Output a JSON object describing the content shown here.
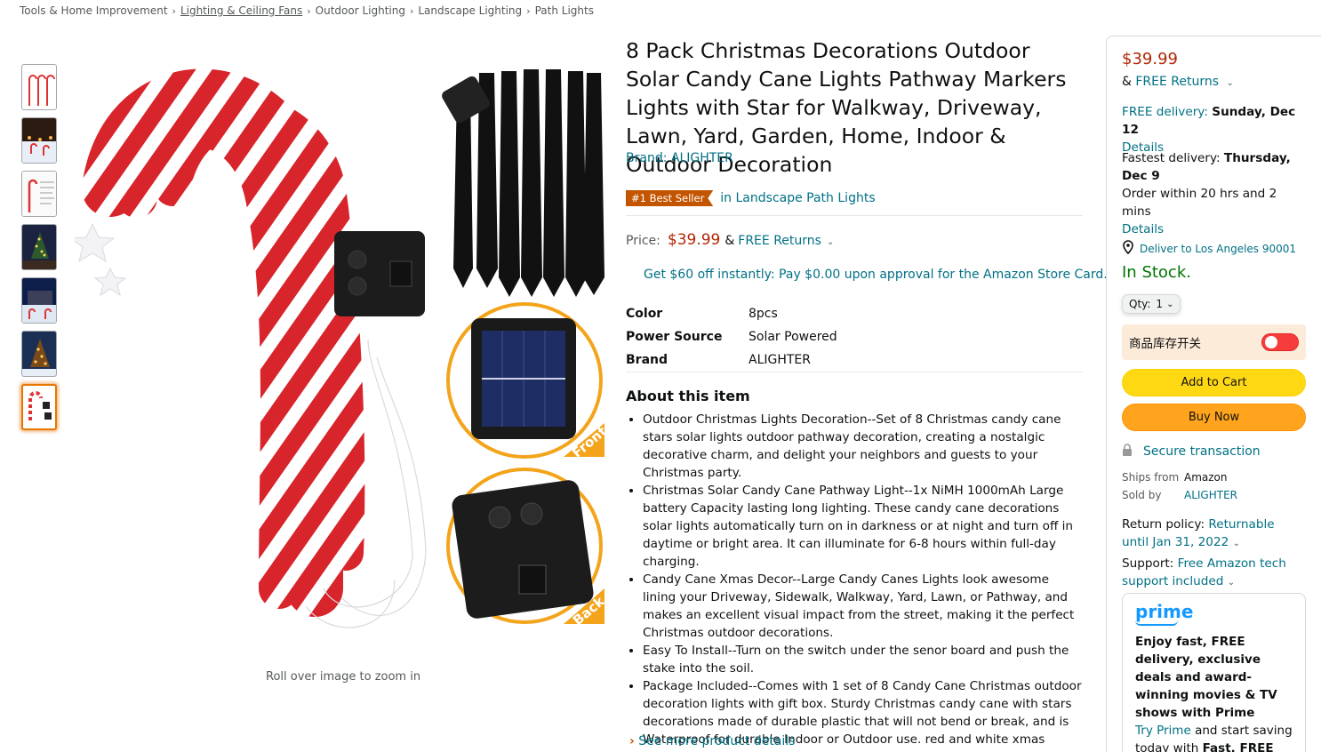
{
  "breadcrumb": {
    "items": [
      "Tools & Home Improvement",
      "Lighting & Ceiling Fans",
      "Outdoor Lighting",
      "Landscape Lighting",
      "Path Lights"
    ],
    "separator": "›"
  },
  "gallery": {
    "zoom_hint": "Roll over image to zoom in",
    "badge_front": "Front",
    "badge_back": "Back"
  },
  "product": {
    "title": "8 Pack Christmas Decorations Outdoor Solar Candy Cane Lights Pathway Markers Lights with Star for Walkway, Driveway, Lawn, Yard, Garden, Home, Indoor & Outdoor Decoration",
    "brand": "Brand: ALIGHTER",
    "best_seller_badge": "#1 Best Seller",
    "best_seller_category": "in Landscape Path Lights",
    "price_label": "Price:",
    "price": "$39.99",
    "returns_amp": "&",
    "returns": "FREE Returns",
    "promo": "Get $60 off instantly: Pay $0.00 upon approval for the Amazon Store Card.",
    "specs": [
      {
        "key": "Color",
        "value": "8pcs"
      },
      {
        "key": "Power Source",
        "value": "Solar Powered"
      },
      {
        "key": "Brand",
        "value": "ALIGHTER"
      }
    ],
    "about_heading": "About this item",
    "bullets": [
      "Outdoor Christmas Lights Decoration--Set of 8 Christmas candy cane stars solar lights outdoor pathway decoration, creating a nostalgic decorative charm, and delight your neighbors and guests to your Christmas party.",
      "Christmas Solar Candy Cane Pathway Light--1x NiMH 1000mAh Large battery Capacity lasting long lighting. These candy cane decorations solar lights automatically turn on in darkness or at night and turn off in daytime or bright area. It can illuminate for 6-8 hours within full-day charging.",
      "Candy Cane Xmas Decor--Large Candy Canes Lights look awesome lining your Driveway, Sidewalk, Walkway, Yard, Lawn, or Pathway, and makes an excellent visual impact from the street, making it the perfect Christmas outdoor decorations.",
      "Easy To Install--Turn on the switch under the senor board and push the stake into the soil.",
      "Package Included--Comes with 1 set of 8 Candy Cane Christmas outdoor decoration lights with gift box. Sturdy Christmas candy cane with stars decorations made of durable plastic that will not bend or break, and is Waterproof for durable Indoor or Outdoor use. red and white xmas holiday decor solar candy cane pathway markers lights with stake set bulk"
    ],
    "see_more": "See more product details"
  },
  "buybox": {
    "price": "$39.99",
    "returns_amp": "&",
    "returns": "FREE Returns",
    "free_delivery_label": "FREE delivery:",
    "free_delivery_date": "Sunday, Dec 12",
    "details": "Details",
    "fastest_label": "Fastest delivery:",
    "fastest_date": "Thursday, Dec 9",
    "order_within": "Order within 20 hrs and 2 mins",
    "deliver_to": "Deliver to Los Angeles 90001",
    "stock": "In Stock.",
    "qty_label": "Qty:",
    "qty_value": "1",
    "toggle_label": "商品库存开关",
    "add_to_cart": "Add to Cart",
    "buy_now": "Buy Now",
    "secure": "Secure transaction",
    "ships_from_label": "Ships from",
    "ships_from": "Amazon",
    "sold_by_label": "Sold by",
    "sold_by": "ALIGHTER",
    "return_policy_label": "Return policy:",
    "return_policy": "Returnable until Jan 31, 2022",
    "support_label": "Support:",
    "support": "Free Amazon tech support included",
    "prime_logo": "prime",
    "prime_text": "Enjoy fast, FREE delivery, exclusive deals and award-winning movies & TV shows with Prime",
    "try_prime": "Try Prime",
    "prime_tail_1": "and start saving today with",
    "prime_tail_2": "Fast, FREE Delivery"
  },
  "colors": {
    "link": "#007185",
    "price": "#B12704",
    "in_stock": "#007600",
    "add_to_cart": "#FFD814",
    "buy_now": "#FFA41C",
    "best_seller": "#C45500"
  }
}
